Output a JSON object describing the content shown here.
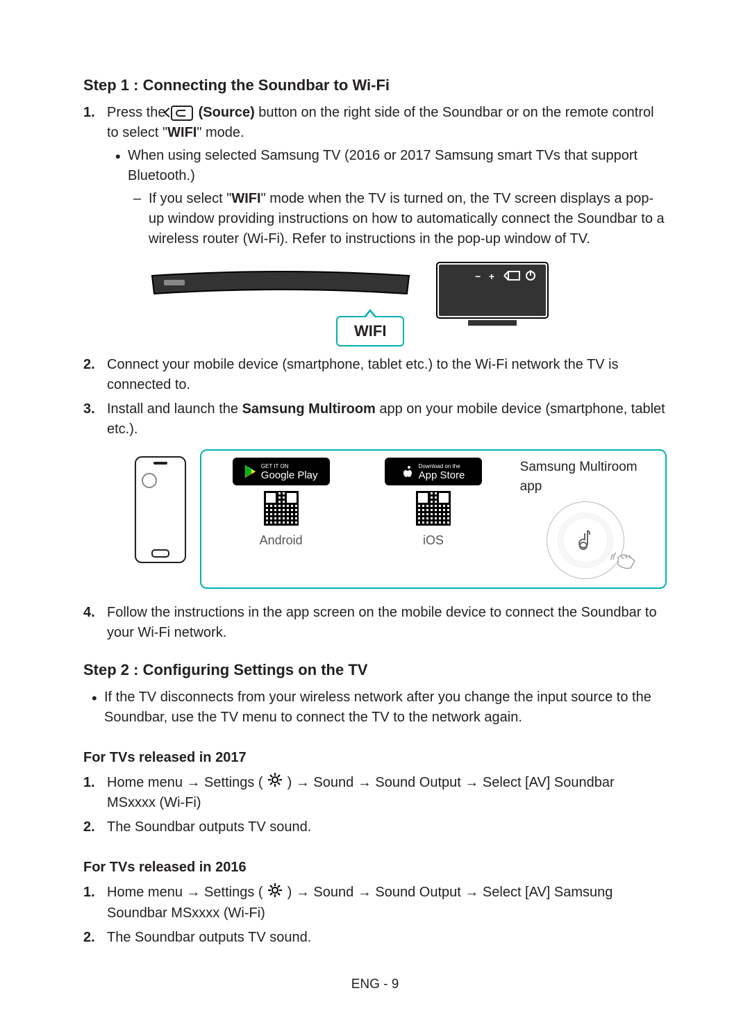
{
  "step1": {
    "heading": "Step 1 : Connecting the Soundbar to Wi-Fi",
    "item1_pre": "Press the ",
    "item1_source": "(Source)",
    "item1_post": " button on the right side of the Soundbar or on the remote control to select \"",
    "item1_wifi": "WIFI",
    "item1_end": "\" mode.",
    "bullet1": "When using selected Samsung TV (2016 or 2017 Samsung smart TVs that support Bluetooth.)",
    "dash1_pre": "If you select \"",
    "dash1_wifi": "WIFI",
    "dash1_post": "\" mode when the TV is turned on, the TV screen displays a pop-up window providing instructions on how to automatically connect the Soundbar to a wireless router (Wi-Fi). Refer to instructions in the pop-up window of TV.",
    "wifi_box": "WIFI",
    "item2": "Connect your mobile device (smartphone, tablet etc.) to the Wi-Fi network the TV is connected to.",
    "item3_pre": "Install and launch the ",
    "item3_app": "Samsung Multiroom",
    "item3_post": " app on your mobile device (smartphone, tablet etc.).",
    "store_google_top": "GET IT ON",
    "store_google_main": "Google Play",
    "store_apple_top": "Download on the",
    "store_apple_main": "App Store",
    "platform_android": "Android",
    "platform_ios": "iOS",
    "multiroom_label": "Samsung Multiroom app",
    "item4": "Follow the instructions in the app screen on the mobile device to connect the Soundbar to your Wi-Fi network."
  },
  "step2": {
    "heading": "Step 2 : Configuring Settings on the TV",
    "bullet": "If the TV disconnects from your wireless network after you change the input source to the Soundbar, use the TV menu to connect the TV to the network again.",
    "sub2017": "For TVs released in 2017",
    "tv2017_item1_pre": "Home menu → Settings ( ",
    "tv2017_item1_post": " ) → Sound → Sound Output → Select [AV] Soundbar MSxxxx (Wi-Fi)",
    "tv_item2": "The Soundbar outputs TV sound.",
    "sub2016": "For TVs released in 2016",
    "tv2016_item1_pre": "Home menu → Settings ( ",
    "tv2016_item1_post": " ) → Sound → Sound Output → Select [AV] Samsung Soundbar MSxxxx (Wi-Fi)"
  },
  "footer": "ENG - 9",
  "nums": {
    "n1": "1.",
    "n2": "2.",
    "n3": "3.",
    "n4": "4."
  }
}
